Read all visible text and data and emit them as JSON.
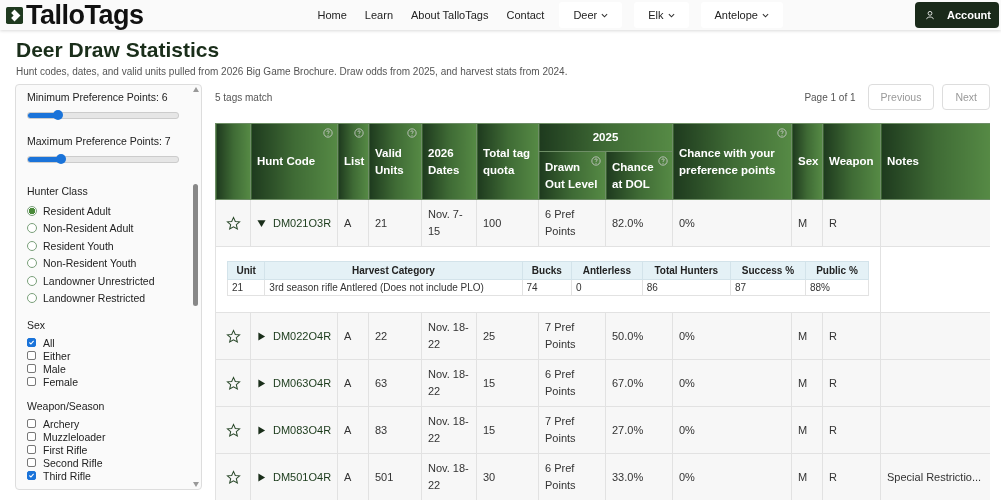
{
  "nav": {
    "brand": "TalloTags",
    "links": [
      {
        "label": "Home",
        "kind": "link"
      },
      {
        "label": "Learn",
        "kind": "link"
      },
      {
        "label": "About TalloTags",
        "kind": "link"
      },
      {
        "label": "Contact",
        "kind": "link"
      },
      {
        "label": "Deer",
        "kind": "dropdown"
      },
      {
        "label": "Elk",
        "kind": "dropdown"
      },
      {
        "label": "Antelope",
        "kind": "dropdown"
      }
    ],
    "account": "Account"
  },
  "page": {
    "title": "Deer Draw Statistics",
    "subtitle": "Hunt codes, dates, and valid units pulled from 2026 Big Game Brochure. Draw odds from 2025, and harvest stats from 2024."
  },
  "sidebar": {
    "sliders": [
      {
        "label": "Minimum Preference Points: 6",
        "level": 0.2
      },
      {
        "label": "Maximum Preference Points: 7",
        "level": 0.22
      }
    ],
    "hunter_class": {
      "title": "Hunter Class",
      "options": [
        {
          "label": "Resident Adult",
          "selected": true
        },
        {
          "label": "Non-Resident Adult",
          "selected": false
        },
        {
          "label": "Resident Youth",
          "selected": false
        },
        {
          "label": "Non-Resident Youth",
          "selected": false
        },
        {
          "label": "Landowner Unrestricted",
          "selected": false
        },
        {
          "label": "Landowner Restricted",
          "selected": false
        }
      ]
    },
    "sex": {
      "title": "Sex",
      "options": [
        {
          "label": "All",
          "checked": true
        },
        {
          "label": "Either",
          "checked": false
        },
        {
          "label": "Male",
          "checked": false
        },
        {
          "label": "Female",
          "checked": false
        }
      ]
    },
    "weapon_season": {
      "title": "Weapon/Season",
      "options": [
        {
          "label": "Archery",
          "checked": false
        },
        {
          "label": "Muzzleloader",
          "checked": false
        },
        {
          "label": "First Rifle",
          "checked": false
        },
        {
          "label": "Second Rifle",
          "checked": false
        },
        {
          "label": "Third Rifle",
          "checked": true
        }
      ]
    }
  },
  "results": {
    "count": "5 tags match",
    "page": "Page 1 of 1",
    "previous": {
      "label": "Previous",
      "disabled": true
    },
    "next": {
      "label": "Next",
      "disabled": true
    }
  },
  "table": {
    "group": "2025",
    "columns": [
      {
        "label": "Hunt Code",
        "help": true,
        "in_group": false
      },
      {
        "label": "List",
        "help": true,
        "in_group": false
      },
      {
        "label": "Valid Units",
        "help": true,
        "in_group": false
      },
      {
        "label": "2026 Dates",
        "help": false,
        "in_group": false
      },
      {
        "label": "Total tag quota",
        "help": false,
        "in_group": false
      },
      {
        "label": "Drawn Out Level",
        "help": true,
        "in_group": true
      },
      {
        "label": "Chance at DOL",
        "help": true,
        "in_group": true
      },
      {
        "label": "Chance with your preference points",
        "help": true,
        "in_group": false
      },
      {
        "label": "Sex",
        "help": false,
        "in_group": false
      },
      {
        "label": "Weapon",
        "help": false,
        "in_group": false
      },
      {
        "label": "Notes",
        "help": false,
        "in_group": false
      }
    ],
    "rows": [
      {
        "starred": false,
        "expanded": true,
        "cells": [
          "DM021O3R",
          "A",
          "21",
          "Nov. 7-15",
          "100",
          "6 Pref Points",
          "82.0%",
          "0%",
          "M",
          "R",
          ""
        ],
        "harvest": {
          "columns": [
            "Unit",
            "Harvest Category",
            "Bucks",
            "Antlerless",
            "Total Hunters",
            "Success %",
            "Public %"
          ],
          "rows": [
            [
              "21",
              "3rd season rifle Antlered (Does not include PLO)",
              "74",
              "0",
              "86",
              "87",
              "88%"
            ]
          ]
        }
      },
      {
        "starred": false,
        "expanded": false,
        "cells": [
          "DM022O4R",
          "A",
          "22",
          "Nov. 18-22",
          "25",
          "7 Pref Points",
          "50.0%",
          "0%",
          "M",
          "R",
          ""
        ]
      },
      {
        "starred": false,
        "expanded": false,
        "cells": [
          "DM063O4R",
          "A",
          "63",
          "Nov. 18-22",
          "15",
          "6 Pref Points",
          "67.0%",
          "0%",
          "M",
          "R",
          ""
        ]
      },
      {
        "starred": false,
        "expanded": false,
        "cells": [
          "DM083O4R",
          "A",
          "83",
          "Nov. 18-22",
          "15",
          "7 Pref Points",
          "27.0%",
          "0%",
          "M",
          "R",
          ""
        ]
      },
      {
        "starred": false,
        "expanded": false,
        "cells": [
          "DM501O4R",
          "A",
          "501",
          "Nov. 18-22",
          "30",
          "6 Pref Points",
          "33.0%",
          "0%",
          "M",
          "R",
          "Special Restrictio..."
        ]
      }
    ]
  }
}
